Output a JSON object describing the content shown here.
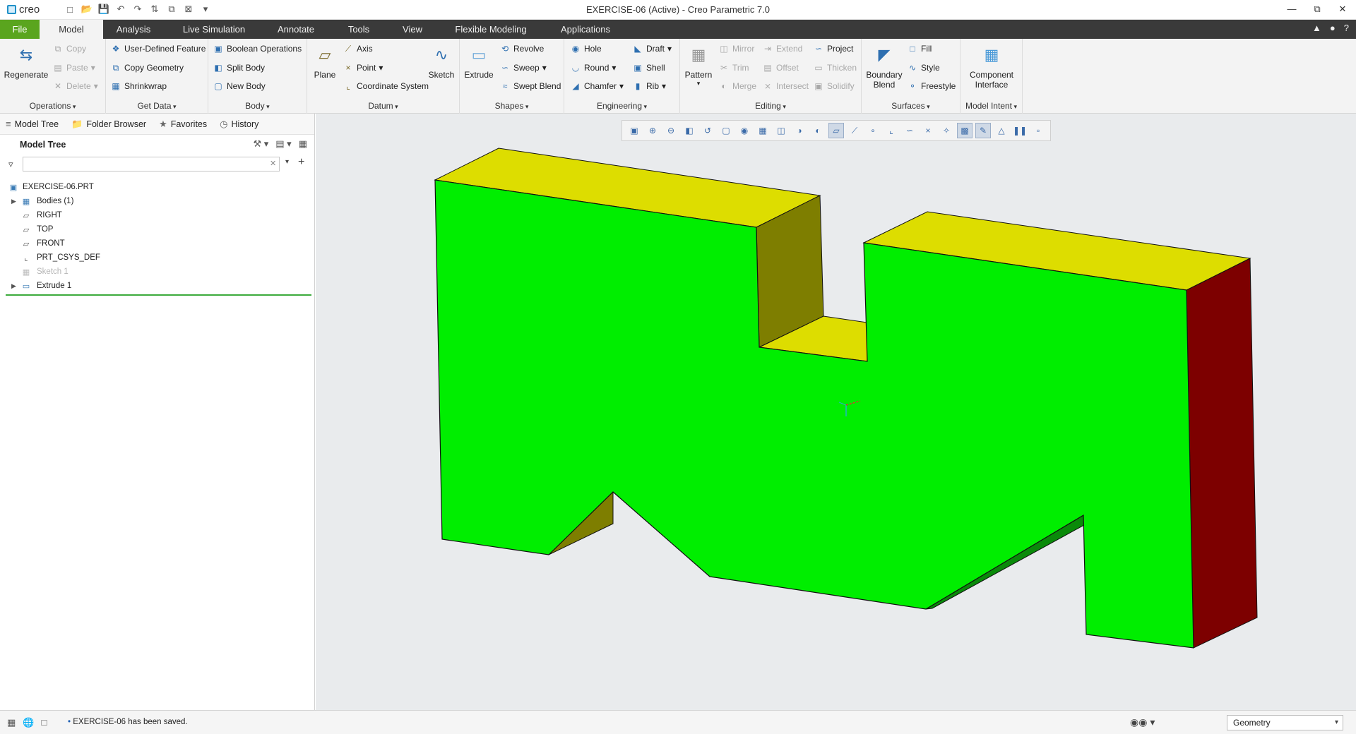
{
  "app": {
    "logo_text": "creo",
    "window_title": "EXERCISE-06 (Active) - Creo Parametric 7.0"
  },
  "menu": {
    "tabs": [
      "File",
      "Model",
      "Analysis",
      "Live Simulation",
      "Annotate",
      "Tools",
      "View",
      "Flexible Modeling",
      "Applications"
    ],
    "active": "Model"
  },
  "ribbon": {
    "operations": {
      "label": "Operations",
      "regenerate": "Regenerate",
      "copy": "Copy",
      "paste": "Paste",
      "delete": "Delete"
    },
    "get_data": {
      "label": "Get Data",
      "udf": "User-Defined Feature",
      "copy_geometry": "Copy Geometry",
      "shrinkwrap": "Shrinkwrap"
    },
    "body": {
      "label": "Body",
      "boolean": "Boolean Operations",
      "split": "Split Body",
      "new": "New Body"
    },
    "datum": {
      "label": "Datum",
      "plane": "Plane",
      "axis": "Axis",
      "point": "Point",
      "csys": "Coordinate System",
      "sketch": "Sketch"
    },
    "shapes": {
      "label": "Shapes",
      "extrude": "Extrude",
      "revolve": "Revolve",
      "sweep": "Sweep",
      "swept_blend": "Swept Blend"
    },
    "engineering": {
      "label": "Engineering",
      "hole": "Hole",
      "round": "Round",
      "chamfer": "Chamfer",
      "draft": "Draft",
      "shell": "Shell",
      "rib": "Rib"
    },
    "editing": {
      "label": "Editing",
      "pattern": "Pattern",
      "mirror": "Mirror",
      "trim": "Trim",
      "merge": "Merge",
      "extend": "Extend",
      "offset": "Offset",
      "intersect": "Intersect",
      "project": "Project",
      "thicken": "Thicken",
      "solidify": "Solidify"
    },
    "surfaces": {
      "label": "Surfaces",
      "boundary_blend_1": "Boundary",
      "boundary_blend_2": "Blend",
      "fill": "Fill",
      "style": "Style",
      "freestyle": "Freestyle"
    },
    "model_intent": {
      "label": "Model Intent",
      "component_1": "Component",
      "component_2": "Interface"
    }
  },
  "navigator": {
    "tabs": [
      "Model Tree",
      "Folder Browser",
      "Favorites",
      "History"
    ],
    "tree_title": "Model Tree",
    "filter_value": "",
    "items": [
      {
        "label": "EXERCISE-06.PRT",
        "icon": "part-icon"
      },
      {
        "label": "Bodies (1)",
        "icon": "bodies-icon",
        "expandable": true
      },
      {
        "label": "RIGHT",
        "icon": "datum-plane-icon"
      },
      {
        "label": "TOP",
        "icon": "datum-plane-icon"
      },
      {
        "label": "FRONT",
        "icon": "datum-plane-icon"
      },
      {
        "label": "PRT_CSYS_DEF",
        "icon": "csys-icon"
      },
      {
        "label": "Sketch 1",
        "icon": "sketch-icon",
        "dimmed": true
      },
      {
        "label": "Extrude 1",
        "icon": "extrude-icon",
        "expandable": true
      }
    ]
  },
  "status": {
    "message": "EXERCISE-06 has been saved.",
    "selection_filter": "Geometry"
  },
  "colors": {
    "front_face": "#00ee00",
    "top_face": "#dddd00",
    "side_face": "#7d0000",
    "inner_face": "#7e7e00",
    "file_tab": "#5aa51e",
    "menubar": "#3a3a3a"
  }
}
